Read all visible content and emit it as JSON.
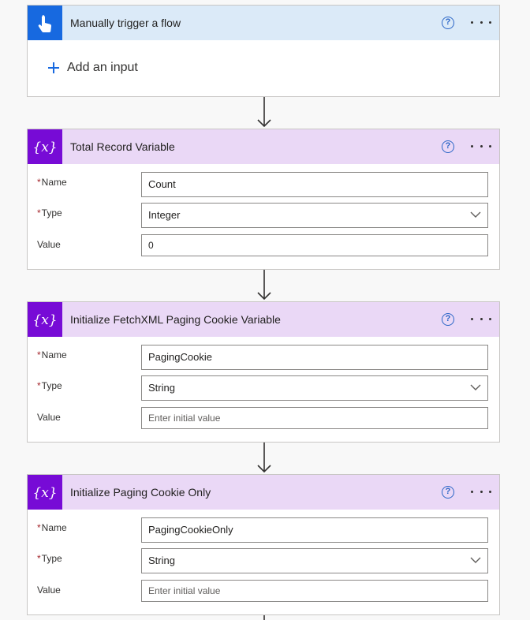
{
  "trigger": {
    "title": "Manually trigger a flow",
    "add_input_label": "Add an input"
  },
  "cards": [
    {
      "title": "Total Record Variable",
      "fields": {
        "name_label": "Name",
        "name_value": "Count",
        "type_label": "Type",
        "type_value": "Integer",
        "value_label": "Value",
        "value_value": "0"
      }
    },
    {
      "title": "Initialize FetchXML Paging Cookie Variable",
      "fields": {
        "name_label": "Name",
        "name_value": "PagingCookie",
        "type_label": "Type",
        "type_value": "String",
        "value_label": "Value",
        "value_placeholder": "Enter initial value"
      }
    },
    {
      "title": "Initialize Paging Cookie Only",
      "fields": {
        "name_label": "Name",
        "name_value": "PagingCookieOnly",
        "type_label": "Type",
        "type_value": "String",
        "value_label": "Value",
        "value_placeholder": "Enter initial value"
      }
    }
  ],
  "common": {
    "required_mark": "*",
    "help_glyph": "?",
    "variable_icon_text": "{x}"
  },
  "icons": {
    "trigger_icon": "touch-hand-icon",
    "variable_icon": "variable-braces-icon",
    "help_icon": "question-circle-icon",
    "more_icon": "ellipsis-icon",
    "add_icon": "plus-icon",
    "dropdown_icon": "chevron-down-icon",
    "connector_icon": "arrow-down-icon"
  },
  "colors": {
    "trigger_header_bg": "#dbeaf8",
    "trigger_icon_bg": "#1769e0",
    "variable_header_bg": "#ead8f6",
    "variable_icon_bg": "#770bd6",
    "required_color": "#a4262c",
    "help_color": "#2b66c7"
  }
}
